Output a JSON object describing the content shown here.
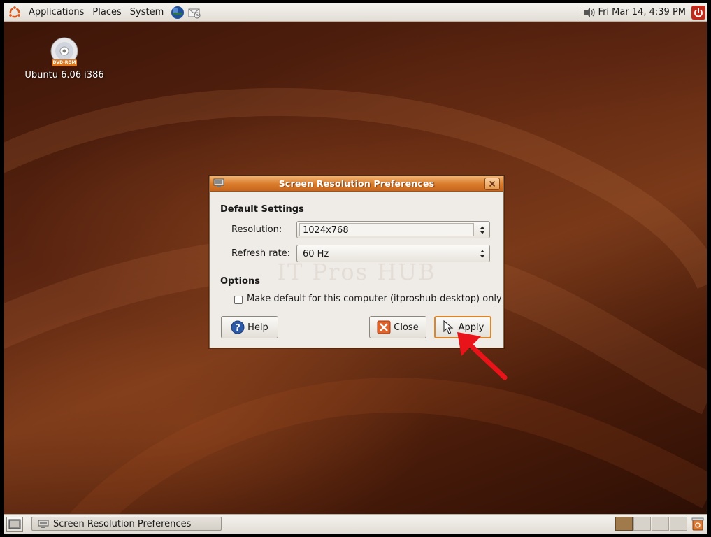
{
  "top_panel": {
    "menus": [
      "Applications",
      "Places",
      "System"
    ],
    "clock": "Fri Mar 14,  4:39 PM"
  },
  "desktop": {
    "icons": [
      {
        "label": "Ubuntu 6.06 i386",
        "badge": "DVD-ROM"
      }
    ]
  },
  "dialog": {
    "title": "Screen Resolution Preferences",
    "default_settings_heading": "Default Settings",
    "resolution_label": "Resolution:",
    "resolution_value": "1024x768",
    "refresh_label": "Refresh rate:",
    "refresh_value": "60 Hz",
    "options_heading": "Options",
    "make_default_label": "Make default for this computer (itproshub-desktop) only",
    "make_default_checked": false,
    "help_label": "Help",
    "close_label": "Close",
    "apply_label": "Apply",
    "watermark": "IT Pros HUB"
  },
  "bottom_panel": {
    "task": "Screen Resolution Preferences",
    "workspace_count": 4,
    "active_workspace": 1
  },
  "colors": {
    "titlebar": "#d97a2a",
    "desktop": "#5a2410",
    "apply_highlight": "#d9862c",
    "annotation_arrow": "#e8141a"
  }
}
